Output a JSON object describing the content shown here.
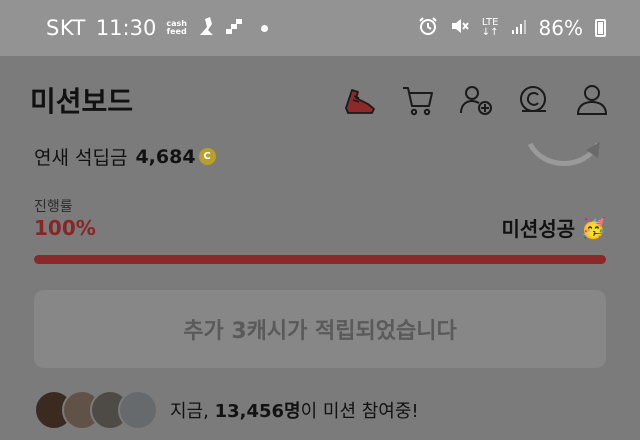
{
  "statusbar": {
    "carrier": "SKT",
    "time": "11:30",
    "cash_line1": "cash",
    "cash_line2": "feed",
    "network_line1": "LTE",
    "network_line2": "↓↑",
    "battery": "86%"
  },
  "header": {
    "title": "미션보드",
    "icons": [
      "sneaker-icon",
      "cart-icon",
      "add-friend-icon",
      "coin-icon",
      "profile-icon"
    ]
  },
  "earnings": {
    "label": "연새 석딥금",
    "value": "4,684",
    "coin_glyph": "C"
  },
  "progress": {
    "label": "진행률",
    "percent_text": "100%",
    "value": 1.0,
    "status": "미션성공",
    "status_icon": "🥳"
  },
  "reward_button": {
    "label": "추가 3캐시가 적립되었습니다"
  },
  "participants": {
    "prefix": "지금, ",
    "count": "13,456명",
    "suffix": "이 미션 참여중!"
  },
  "colors": {
    "accent": "#8b2929",
    "overlay": "#7b7b7b"
  }
}
